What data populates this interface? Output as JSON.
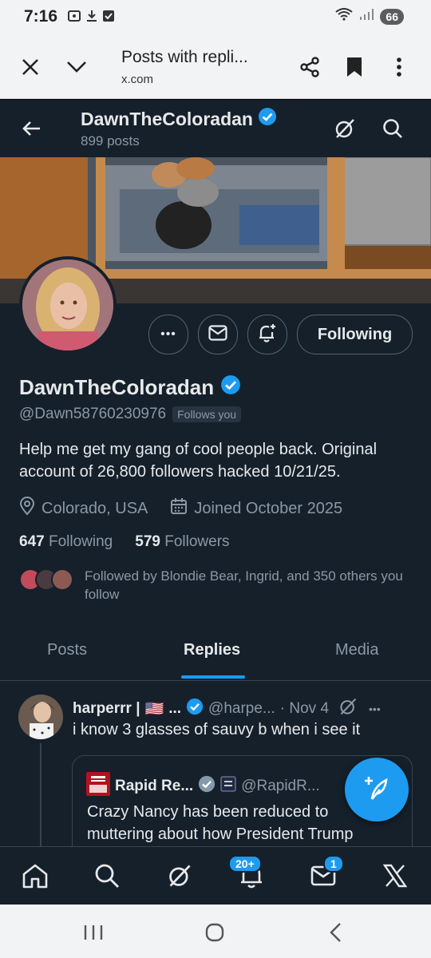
{
  "status_bar": {
    "time": "7:16",
    "battery": "66"
  },
  "browser": {
    "tab_title": "Posts with repli...",
    "url": "x.com"
  },
  "header": {
    "name": "DawnTheColoradan",
    "posts_count": "899 posts"
  },
  "profile": {
    "name": "DawnTheColoradan",
    "handle": "@Dawn58760230976",
    "follows_you": "Follows you",
    "bio": "Help me get my gang of cool people back. Original account of 26,800 followers hacked 10/21/25.",
    "location": "Colorado, USA",
    "joined": "Joined October 2025",
    "following_count": "647",
    "following_label": "Following",
    "followers_count": "579",
    "followers_label": "Followers",
    "followed_by": "Followed by Blondie Bear, Ingrid, and 350 others you follow",
    "following_button": "Following",
    "more_button": "•••"
  },
  "tabs": [
    {
      "label": "Posts"
    },
    {
      "label": "Replies"
    },
    {
      "label": "Media"
    }
  ],
  "tweet": {
    "name": "harperrr |",
    "flag": "🇺🇸",
    "ellipsis": "...",
    "handle": "@harpe...",
    "time": "· Nov 4",
    "more": "•••",
    "text": "i know 3 glasses of sauvy b when i see it",
    "quote": {
      "name": "Rapid Re...",
      "handle": "@RapidR...",
      "text": "Crazy Nancy has been reduced to muttering about how President Trump"
    }
  },
  "bottom_nav": {
    "notifications_badge": "20+",
    "messages_badge": "1"
  },
  "colors": {
    "background": "#15202b",
    "accent": "#1d9bf0",
    "text": "#e7e9ea",
    "muted": "#8b98a5",
    "border": "#38444d"
  }
}
